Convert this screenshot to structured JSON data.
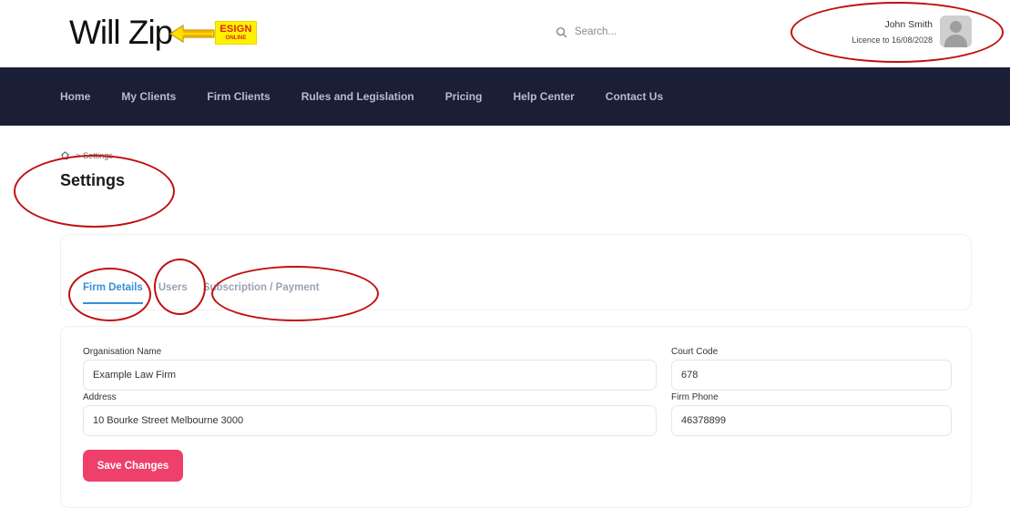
{
  "header": {
    "logo_text": "Will Zip",
    "esign_big": "ESIGN",
    "esign_small": "ONLINE",
    "search_placeholder": "Search...",
    "user_name": "John Smith",
    "licence_text": "Licence to 16/08/2028"
  },
  "nav": {
    "items": [
      "Home",
      "My Clients",
      "Firm Clients",
      "Rules and Legislation",
      "Pricing",
      "Help Center",
      "Contact Us"
    ]
  },
  "breadcrumb": {
    "current": "Settings",
    "separator": ">"
  },
  "page_title": "Settings",
  "tabs": {
    "items": [
      "Firm Details",
      "Users",
      "Subscription / Payment"
    ],
    "active_index": 0
  },
  "form": {
    "org_name_label": "Organisation Name",
    "org_name_value": "Example Law Firm",
    "address_label": "Address",
    "address_value": "10 Bourke Street Melbourne 3000",
    "court_code_label": "Court Code",
    "court_code_value": "678",
    "firm_phone_label": "Firm Phone",
    "firm_phone_value": "46378899",
    "save_label": "Save Changes"
  },
  "colors": {
    "nav_bg": "#1b1e37",
    "accent_blue": "#3a8fd6",
    "save_button": "#ef3f6b",
    "annotation_red": "#c00f0f",
    "esign_yellow": "#fff200"
  }
}
